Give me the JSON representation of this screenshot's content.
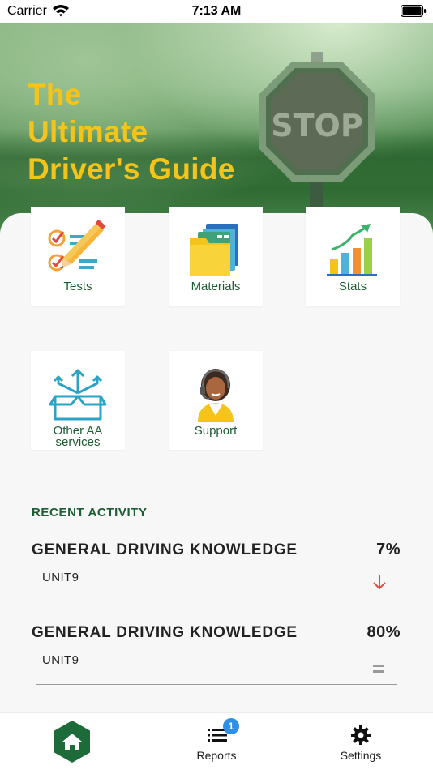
{
  "status_bar": {
    "carrier": "Carrier",
    "time": "7:13 AM"
  },
  "hero": {
    "title_line1": "The",
    "title_line2": "Ultimate",
    "title_line3": "Driver's Guide",
    "sign_text": "STOP",
    "title_color": "#f5c41a"
  },
  "tiles": [
    {
      "label": "Tests",
      "icon": "checklist-pencil-icon"
    },
    {
      "label": "Materials",
      "icon": "folders-icon"
    },
    {
      "label": "Stats",
      "icon": "bar-chart-growth-icon"
    },
    {
      "label_line1": "Other AA",
      "label_line2": "services",
      "icon": "box-arrows-icon"
    },
    {
      "label": "Support",
      "icon": "support-agent-icon"
    }
  ],
  "recent_activity": {
    "heading": "RECENT ACTIVITY",
    "items": [
      {
        "title": "GENERAL DRIVING KNOWLEDGE",
        "unit": "UNIT9",
        "score": "7%",
        "trend": "down",
        "trend_color": "#e2483d"
      },
      {
        "title": "GENERAL DRIVING KNOWLEDGE",
        "unit": "UNIT9",
        "score": "80%",
        "trend": "equal",
        "trend_color": "#9a9a9a"
      }
    ]
  },
  "tab_bar": {
    "tabs": [
      {
        "id": "home",
        "label": "",
        "icon": "home-icon",
        "active": true
      },
      {
        "id": "reports",
        "label": "Reports",
        "icon": "list-icon",
        "badge": "1"
      },
      {
        "id": "settings",
        "label": "Settings",
        "icon": "gear-icon"
      }
    ],
    "accent_color": "#1e6b3a",
    "badge_color": "#2f8ee8"
  }
}
